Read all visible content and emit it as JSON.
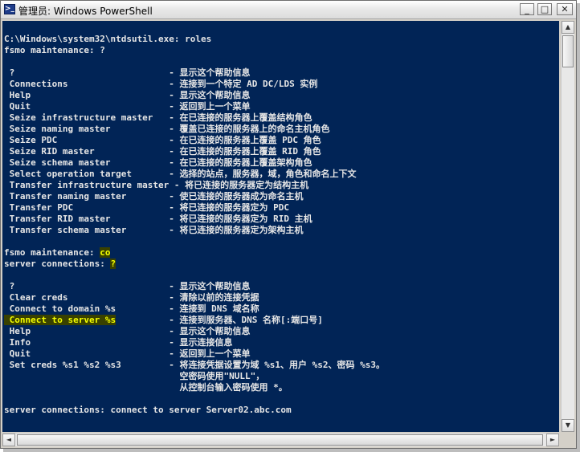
{
  "window": {
    "title": "管理员: Windows PowerShell",
    "icon_label": ">_",
    "minimize_label": "_",
    "maximize_label": "□",
    "close_label": "✕"
  },
  "scrollbars": {
    "up_arrow": "▲",
    "down_arrow": "▼",
    "left_arrow": "◄",
    "right_arrow": "►"
  },
  "console": {
    "lines": [
      {
        "text": ""
      },
      {
        "text": "C:\\Windows\\system32\\ntdsutil.exe: roles"
      },
      {
        "text": "fsmo maintenance: ?"
      },
      {
        "text": ""
      },
      {
        "text": " ?                             - 显示这个帮助信息"
      },
      {
        "text": " Connections                   - 连接到一个特定 AD DC/LDS 实例"
      },
      {
        "text": " Help                          - 显示这个帮助信息"
      },
      {
        "text": " Quit                          - 返回到上一个菜单"
      },
      {
        "text": " Seize infrastructure master   - 在已连接的服务器上覆盖结构角色"
      },
      {
        "text": " Seize naming master           - 覆盖已连接的服务器上的命名主机角色"
      },
      {
        "text": " Seize PDC                     - 在已连接的服务器上覆盖 PDC 角色"
      },
      {
        "text": " Seize RID master              - 在已连接的服务器上覆盖 RID 角色"
      },
      {
        "text": " Seize schema master           - 在已连接的服务器上覆盖架构角色"
      },
      {
        "text": " Select operation target       - 选择的站点，服务器，域，角色和命名上下文"
      },
      {
        "text": " Transfer infrastructure master - 将已连接的服务器定为结构主机"
      },
      {
        "text": " Transfer naming master        - 使已连接的服务器成为命名主机"
      },
      {
        "text": " Transfer PDC                  - 将已连接的服务器定为 PDC"
      },
      {
        "text": " Transfer RID master           - 将已连接的服务器定为 RID 主机"
      },
      {
        "text": " Transfer schema master        - 将已连接的服务器定为架构主机"
      },
      {
        "text": ""
      },
      {
        "text": "fsmo maintenance: ",
        "highlight": "co"
      },
      {
        "text": "server connections: ",
        "highlight": "?"
      },
      {
        "text": ""
      },
      {
        "text": " ?                             - 显示这个帮助信息"
      },
      {
        "text": " Clear creds                   - 清除以前的连接凭据"
      },
      {
        "text": " Connect to domain %s          - 连接到 DNS 域名称"
      },
      {
        "text": "",
        "highlight": " Connect to server %s",
        "after": "          - 连接到服务器、DNS 名称[:端口号]"
      },
      {
        "text": " Help                          - 显示这个帮助信息"
      },
      {
        "text": " Info                          - 显示连接信息"
      },
      {
        "text": " Quit                          - 返回到上一个菜单"
      },
      {
        "text": " Set creds %s1 %s2 %s3         - 将连接凭据设置为域 %s1、用户 %s2、密码 %s3。"
      },
      {
        "text": "                                 空密码使用\"NULL\"，"
      },
      {
        "text": "                                 从控制台输入密码使用 *。"
      },
      {
        "text": ""
      },
      {
        "text": "server connections: connect to server Server02.abc.com"
      }
    ]
  }
}
